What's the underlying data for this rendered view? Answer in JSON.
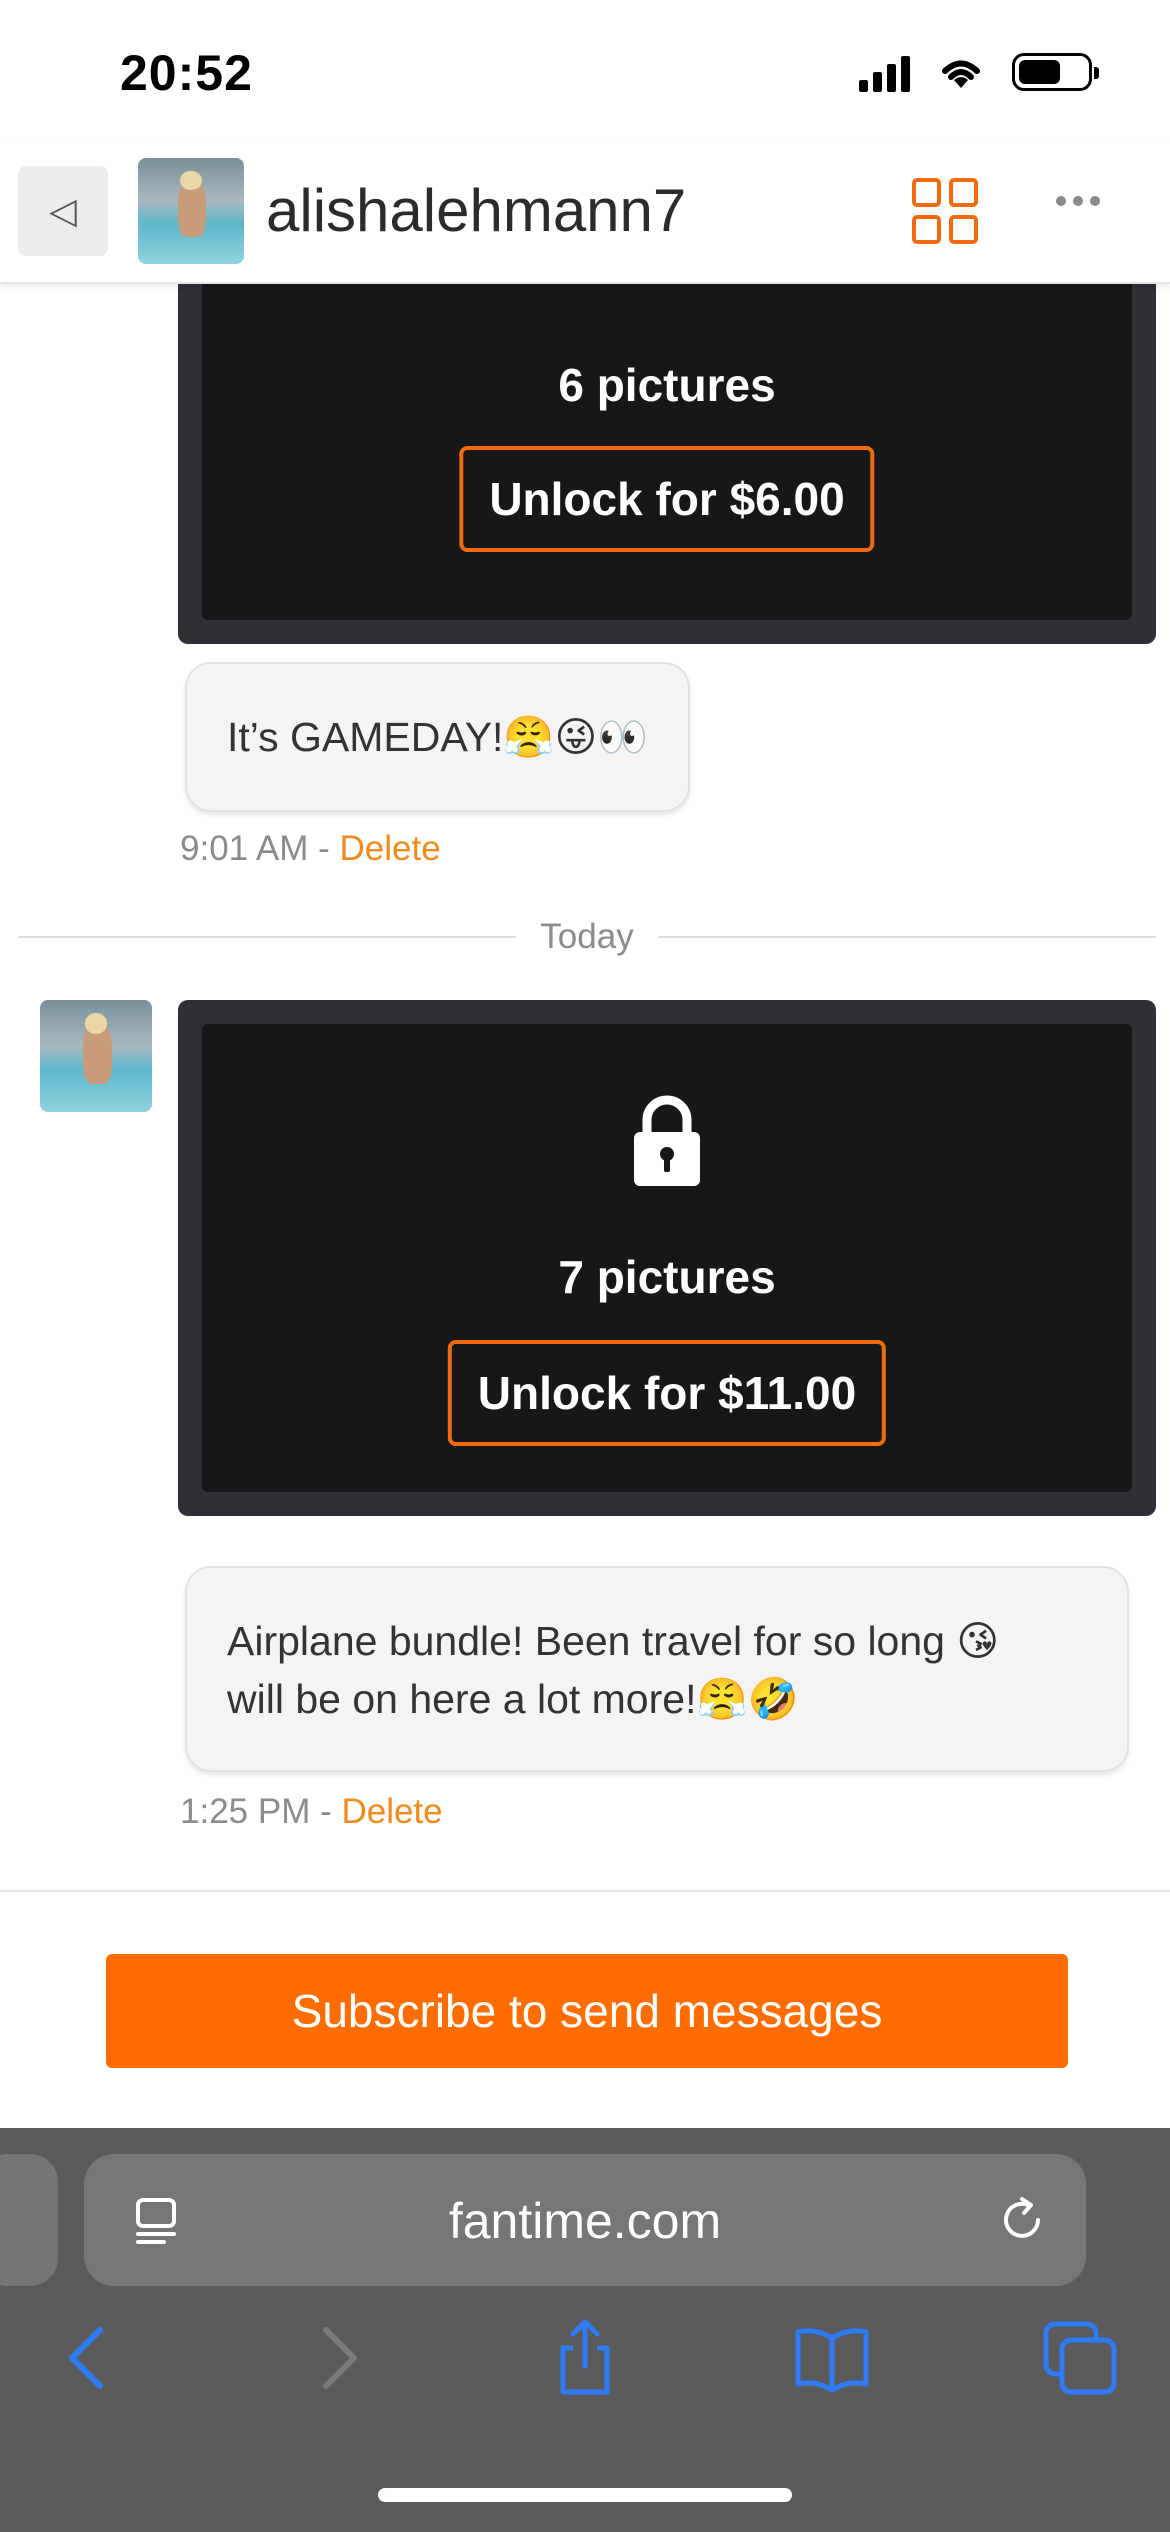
{
  "status_bar": {
    "time": "20:52"
  },
  "header": {
    "username": "alishalehmann7"
  },
  "messages": [
    {
      "media": {
        "count_label": "6 pictures",
        "unlock_label": "Unlock for $6.00"
      },
      "text": "It’s GAMEDAY!😤😜👀",
      "time": "9:01 AM",
      "separator": " - ",
      "delete_label": "Delete"
    },
    {
      "media": {
        "count_label": "7 pictures",
        "unlock_label": "Unlock for $11.00"
      },
      "text_line1": "Airplane bundle! Been travel for so long 😘",
      "text_line2": "will be on here a lot more!😤🤣",
      "time": "1:25 PM",
      "separator": " - ",
      "delete_label": "Delete"
    }
  ],
  "date_divider": "Today",
  "composer": {
    "subscribe_label": "Subscribe to send messages"
  },
  "browser": {
    "url": "fantime.com"
  },
  "colors": {
    "accent": "#ff6d00",
    "media_bg": "#161718",
    "toolbar_bg": "#5b5b5d",
    "link": "#f08a1c",
    "nav_blue": "#2f7cf6"
  }
}
